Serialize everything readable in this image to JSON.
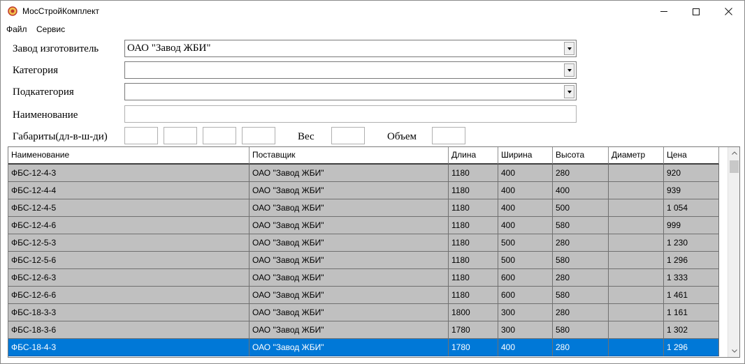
{
  "window": {
    "title": "МосСтройКомплект"
  },
  "menu": {
    "file": "Файл",
    "service": "Сервис"
  },
  "form": {
    "manufacturer_label": "Завод изготовитель",
    "manufacturer_value": "ОАО \"Завод ЖБИ\"",
    "category_label": "Категория",
    "category_value": "",
    "subcategory_label": "Подкатегория",
    "subcategory_value": "",
    "name_label": "Наименование",
    "name_value": "",
    "dimensions_label": "Габариты(дл-в-ш-ди)",
    "weight_label": "Вес",
    "volume_label": "Объем"
  },
  "grid": {
    "columns": [
      "Наименование",
      "Поставщик",
      "Длина",
      "Ширина",
      "Высота",
      "Диаметр",
      "Цена"
    ],
    "rows": [
      [
        "ФБС-12-4-3",
        "ОАО \"Завод ЖБИ\"",
        "1180",
        "400",
        "280",
        "",
        "920"
      ],
      [
        "ФБС-12-4-4",
        "ОАО \"Завод ЖБИ\"",
        "1180",
        "400",
        "400",
        "",
        "939"
      ],
      [
        "ФБС-12-4-5",
        "ОАО \"Завод ЖБИ\"",
        "1180",
        "400",
        "500",
        "",
        "1 054"
      ],
      [
        "ФБС-12-4-6",
        "ОАО \"Завод ЖБИ\"",
        "1180",
        "400",
        "580",
        "",
        "999"
      ],
      [
        "ФБС-12-5-3",
        "ОАО \"Завод ЖБИ\"",
        "1180",
        "500",
        "280",
        "",
        "1 230"
      ],
      [
        "ФБС-12-5-6",
        "ОАО \"Завод ЖБИ\"",
        "1180",
        "500",
        "580",
        "",
        "1 296"
      ],
      [
        "ФБС-12-6-3",
        "ОАО \"Завод ЖБИ\"",
        "1180",
        "600",
        "280",
        "",
        "1 333"
      ],
      [
        "ФБС-12-6-6",
        "ОАО \"Завод ЖБИ\"",
        "1180",
        "600",
        "580",
        "",
        "1 461"
      ],
      [
        "ФБС-18-3-3",
        "ОАО \"Завод ЖБИ\"",
        "1800",
        "300",
        "280",
        "",
        "1 161"
      ],
      [
        "ФБС-18-3-6",
        "ОАО \"Завод ЖБИ\"",
        "1780",
        "300",
        "580",
        "",
        "1 302"
      ],
      [
        "ФБС-18-4-3",
        "ОАО \"Завод ЖБИ\"",
        "1780",
        "400",
        "280",
        "",
        "1 296"
      ]
    ],
    "selected_row": 10
  },
  "icons": {
    "app": "app-logo-icon",
    "minimize": "minimize-icon",
    "maximize": "maximize-icon",
    "close": "close-icon",
    "dropdown": "chevron-down-icon",
    "scroll_up": "scroll-up-icon",
    "scroll_down": "scroll-down-icon"
  },
  "colors": {
    "selection": "#0078d7",
    "row_background": "#c0c0c0"
  }
}
